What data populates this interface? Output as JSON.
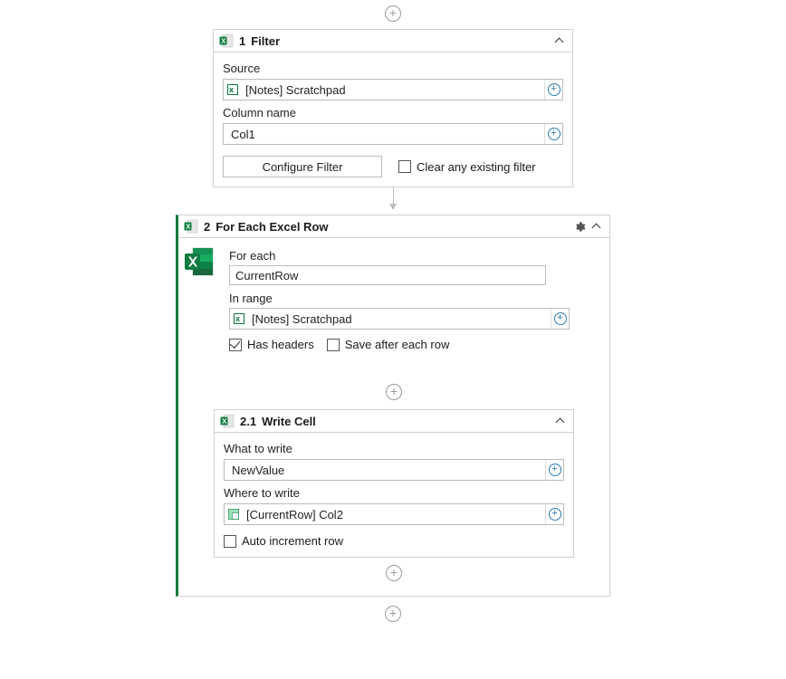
{
  "add_button_title": "Add step",
  "filter": {
    "index": "1",
    "title": "Filter",
    "source_label": "Source",
    "source_value": "[Notes] Scratchpad",
    "column_label": "Column name",
    "column_value": "Col1",
    "configure_btn": "Configure Filter",
    "clear_checkbox": "Clear any existing filter",
    "clear_checked": false
  },
  "foreach": {
    "index": "2",
    "title": "For Each Excel Row",
    "for_each_label": "For each",
    "for_each_value": "CurrentRow",
    "in_range_label": "In range",
    "in_range_value": "[Notes] Scratchpad",
    "has_headers_label": "Has headers",
    "has_headers_checked": true,
    "save_each_label": "Save after each row",
    "save_each_checked": false
  },
  "writecell": {
    "index": "2.1",
    "title": "Write Cell",
    "what_label": "What to write",
    "what_value": "NewValue",
    "where_label": "Where to write",
    "where_value": "[CurrentRow] Col2",
    "auto_inc_label": "Auto increment row",
    "auto_inc_checked": false
  }
}
